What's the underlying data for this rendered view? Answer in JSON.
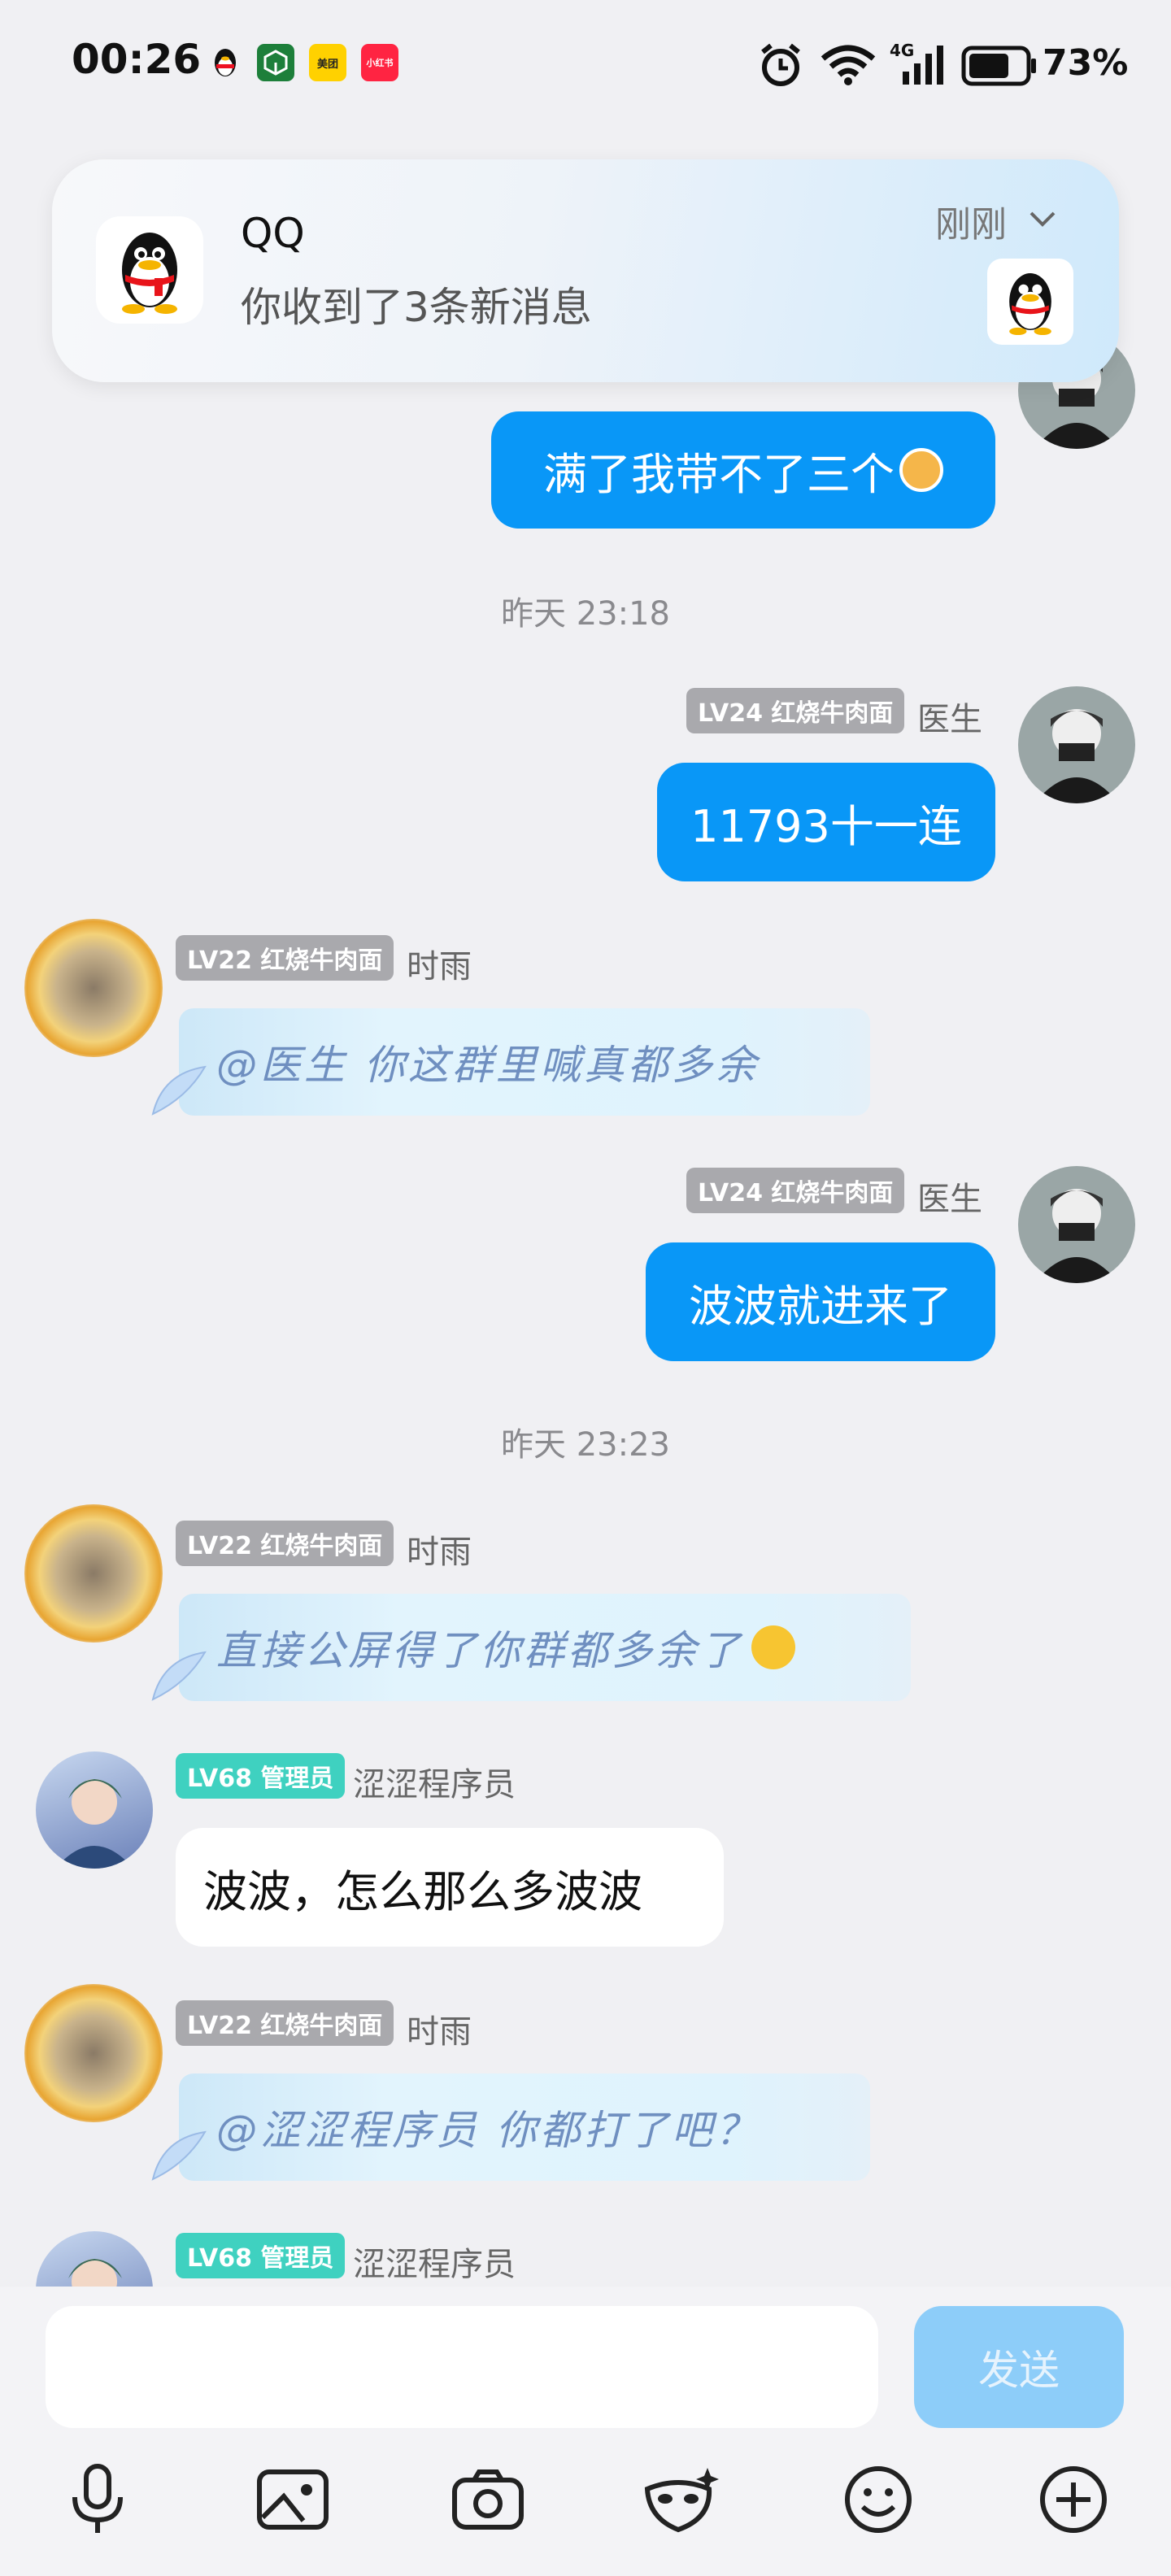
{
  "status_bar": {
    "time": "00:26",
    "notification_apps": [
      {
        "name": "qq-app-icon",
        "label": "",
        "bg": "#ffffff"
      },
      {
        "name": "green-app-icon",
        "label": "",
        "bg": "#1f8a3a"
      },
      {
        "name": "meituan-app-icon",
        "label": "美团",
        "bg": "#ffd100"
      },
      {
        "name": "xiaohongshu-app-icon",
        "label": "小红书",
        "bg": "#ff2442"
      }
    ],
    "network": "4G",
    "battery_percent": "73%",
    "battery_level": 0.73
  },
  "notification": {
    "app": "QQ",
    "message": "你收到了3条新消息",
    "time": "刚刚"
  },
  "messages": {
    "m1_text": "满了我带不了三个",
    "ts1": "昨天 23:18",
    "m2_badge": "LV24 红烧牛肉面",
    "m2_sender": "医生",
    "m2_text": "11793十一连",
    "m3_badge": "LV22 红烧牛肉面",
    "m3_sender": "时雨",
    "m3_text": "@医生 你这群里喊真都多余",
    "m4_badge": "LV24 红烧牛肉面",
    "m4_sender": "医生",
    "m4_text": "波波就进来了",
    "ts2": "昨天 23:23",
    "m5_badge": "LV22 红烧牛肉面",
    "m5_sender": "时雨",
    "m5_text": "直接公屏得了你群都多余了",
    "m6_badge": "LV68 管理员",
    "m6_sender": "涩涩程序员",
    "m6_text": "波波，怎么那么多波波",
    "m7_badge": "LV22 红烧牛肉面",
    "m7_sender": "时雨",
    "m7_text": "@涩涩程序员 你都打了吧？",
    "m8_badge": "LV68 管理员",
    "m8_sender": "涩涩程序员"
  },
  "input": {
    "placeholder": "",
    "send_label": "发送"
  },
  "toolbar": [
    "mic-icon",
    "image-icon",
    "camera-icon",
    "mask-icon",
    "emoji-icon",
    "plus-icon"
  ],
  "colors": {
    "my_bubble": "#0997f7",
    "send_button": "#8dcdf9",
    "level_badge": "#a9a9ad",
    "admin_badge": "#3fd1c0"
  }
}
